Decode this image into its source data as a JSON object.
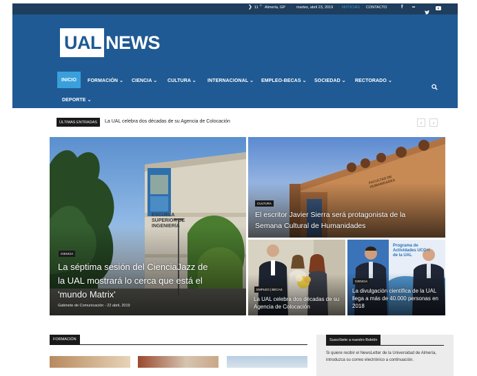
{
  "topbar": {
    "weather_temp": "11",
    "weather_unit": "C",
    "weather_city": "Almería, GP",
    "date": "martes, abril 23, 2019",
    "links": [
      "NOTICIAS",
      "CONTACTO"
    ],
    "social": [
      "facebook-icon",
      "flickr-icon",
      "twitter-icon",
      "youtube-icon"
    ]
  },
  "brand": {
    "logo_box": "UAL",
    "logo_rest": "NEWS",
    "bg": "#1f5a94",
    "topbar_bg": "#1f3d5c",
    "accent": "#3aa0dc"
  },
  "nav": {
    "items": [
      "INICIO",
      "FORMACIÓN",
      "CIENCIA",
      "CULTURA",
      "INTERNACIONAL",
      "EMPLEO-BECAS",
      "SOCIEDAD",
      "RECTORADO",
      "DEPORTE"
    ]
  },
  "ticker": {
    "label": "ÚLTIMAS ENTRADAS",
    "text": "La UAL celebra dos décadas de su Agencia de Colocación"
  },
  "featured": [
    {
      "category": "CIENCIA",
      "title": "La séptima sesión del CienciaJazz de la UAL mostrará lo cerca que está el 'mundo Matrix'",
      "author": "Gabinete de Comunicación",
      "date": "22 abril, 2019",
      "sign_text": "ESCUELA SUPERIOR DE INGENIERÍA"
    },
    {
      "category": "CULTURA",
      "title": "El escritor Javier Sierra será protagonista de la Semana Cultural de Humanidades",
      "sign_text": "FACULTAD DE HUMANIDADES"
    },
    {
      "category": "EMPLEO | BECAS",
      "title": "La UAL celebra dos décadas de su Agencia de Colocación"
    },
    {
      "category": "CIENCIA",
      "title": "La divulgación científica de la UAL llega a más de 40.000 personas en 2018",
      "banner_text": "Programa de Actividades UCC+i de la UAL"
    }
  ],
  "sections": {
    "formacion_label": "FORMACIÓN"
  },
  "sidebar": {
    "label": "Suscríbete a nuestro Boletín",
    "text": "Si quiere recibir el NewsLetter de la Universidad de Almería, introduzca su correo electrónico a continuación."
  }
}
